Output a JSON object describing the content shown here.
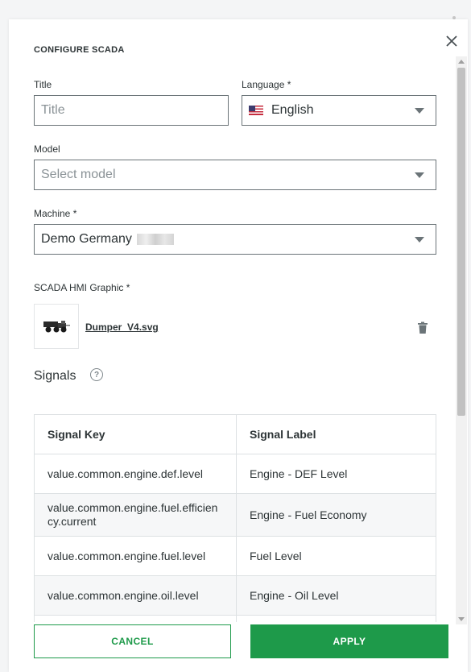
{
  "dialog": {
    "title": "CONFIGURE SCADA",
    "close_icon": "close-icon"
  },
  "form": {
    "title_label": "Title",
    "title_placeholder": "Title",
    "title_value": "",
    "language_label": "Language *",
    "language_value": "English",
    "language_flag": "us-flag-icon",
    "model_label": "Model",
    "model_placeholder": "Select model",
    "machine_label": "Machine *",
    "machine_value": "Demo Germany",
    "graphic_label": "SCADA HMI Graphic *",
    "graphic_file": "Dumper_V4.svg"
  },
  "signals": {
    "heading": "Signals",
    "help_icon": "?",
    "columns": [
      "Signal Key",
      "Signal Label"
    ],
    "rows": [
      {
        "key": "value.common.engine.def.level",
        "label": "Engine - DEF Level"
      },
      {
        "key": "value.common.engine.fuel.efficiency.current",
        "label": "Engine - Fuel Economy"
      },
      {
        "key": "value.common.engine.fuel.level",
        "label": "Fuel Level"
      },
      {
        "key": "value.common.engine.oil.level",
        "label": "Engine - Oil Level"
      },
      {
        "key": "",
        "label": ""
      }
    ]
  },
  "actions": {
    "cancel_label": "CANCEL",
    "apply_label": "APPLY"
  },
  "colors": {
    "primary": "#1e9a4a",
    "border": "#6b7478",
    "text": "#2d3436"
  }
}
